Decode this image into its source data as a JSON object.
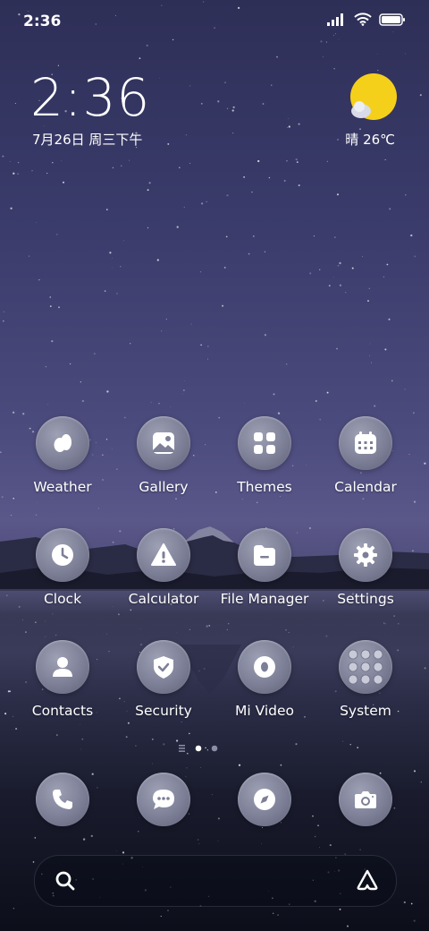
{
  "status_bar": {
    "time": "2:36"
  },
  "widget": {
    "time": "2:36",
    "date": "7月26日 周三下午",
    "weather": "晴 26℃"
  },
  "apps": [
    {
      "label": "Weather",
      "icon": "weather-drops-icon"
    },
    {
      "label": "Gallery",
      "icon": "image-icon"
    },
    {
      "label": "Themes",
      "icon": "grid-icon"
    },
    {
      "label": "Calendar",
      "icon": "calendar-icon"
    },
    {
      "label": "Clock",
      "icon": "clock-icon"
    },
    {
      "label": "Calculator",
      "icon": "warning-icon"
    },
    {
      "label": "File Manager",
      "icon": "folder-icon"
    },
    {
      "label": "Settings",
      "icon": "gear-icon"
    },
    {
      "label": "Contacts",
      "icon": "person-icon"
    },
    {
      "label": "Security",
      "icon": "shield-icon"
    },
    {
      "label": "Mi Video",
      "icon": "video-icon"
    },
    {
      "label": "System",
      "icon": "app-folder-icon"
    }
  ],
  "dock": [
    {
      "icon": "phone-icon"
    },
    {
      "icon": "message-icon"
    },
    {
      "icon": "compass-icon"
    },
    {
      "icon": "camera-icon"
    }
  ],
  "pages": {
    "count": 2,
    "current": 1
  },
  "colors": {
    "sun": "#f5d01a",
    "icon_bg": "#7c7f96"
  }
}
